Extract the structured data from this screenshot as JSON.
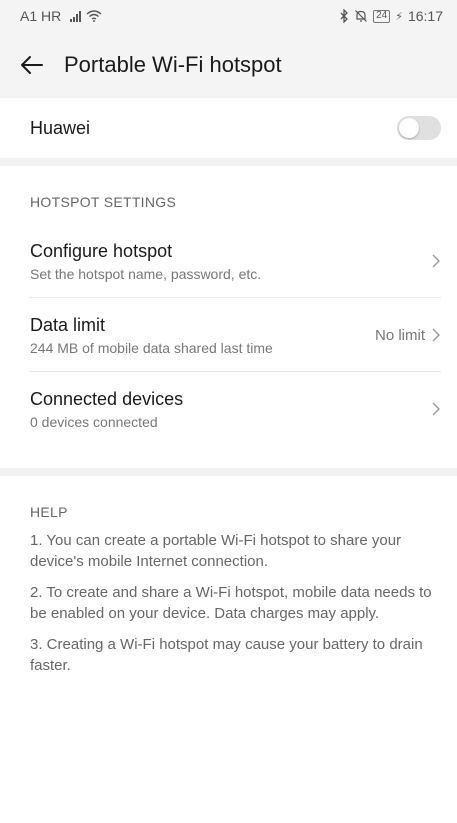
{
  "status_bar": {
    "carrier": "A1 HR",
    "battery": "24",
    "time": "16:17"
  },
  "header": {
    "title": "Portable Wi-Fi hotspot"
  },
  "hotspot_master": {
    "label": "Huawei",
    "enabled": false
  },
  "hotspot_settings": {
    "section_title": "HOTSPOT SETTINGS",
    "items": [
      {
        "title": "Configure hotspot",
        "subtitle": "Set the hotspot name, password, etc.",
        "value": ""
      },
      {
        "title": "Data limit",
        "subtitle": "244 MB of mobile data shared last time",
        "value": "No limit"
      },
      {
        "title": "Connected devices",
        "subtitle": "0 devices connected",
        "value": ""
      }
    ]
  },
  "help": {
    "section_title": "HELP",
    "paragraphs": [
      "1. You can create a portable Wi-Fi hotspot to share your device's mobile Internet connection.",
      "2. To create and share a Wi-Fi hotspot, mobile data needs to be enabled on your device. Data charges may apply.",
      "3. Creating a Wi-Fi hotspot may cause your battery to drain faster."
    ]
  },
  "colors": {
    "page_background": "#ffffff",
    "header_background": "#f4f4f4",
    "divider_band": "#f1f1f1",
    "switch_off": "#e0e0e0"
  },
  "icons": {
    "back": "arrow-left-icon",
    "chevron": "chevron-right-icon",
    "signal": "signal-bars-icon",
    "wifi": "wifi-icon",
    "bluetooth": "bluetooth-icon",
    "mute": "mute-icon",
    "battery": "battery-icon",
    "charging": "charging-icon"
  }
}
